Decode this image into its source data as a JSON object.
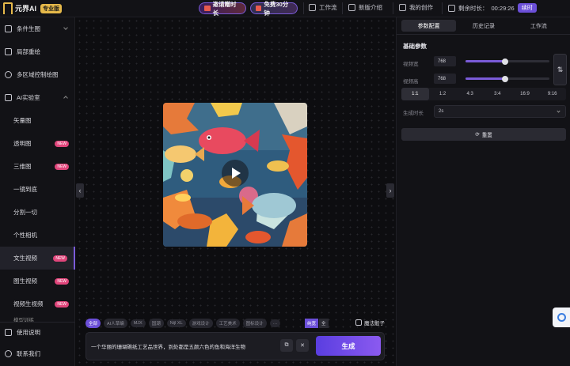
{
  "app": {
    "logo_text": "元界AI",
    "edition_badge": "专业版",
    "promo_invite": "邀请赠时长",
    "promo_free": "免费30分钟"
  },
  "topnav": {
    "workflow": "工作流",
    "new_intro": "新版介绍",
    "my_creations": "我的创作",
    "remaining_label": "剩余时长：",
    "remaining_time": "00:29:26",
    "renew_label": "续时"
  },
  "sidebar": {
    "items": [
      {
        "label": "条件生图",
        "icon": "grid-icon"
      },
      {
        "label": "局部重绘",
        "icon": "layers-icon"
      },
      {
        "label": "多区域控制绘图",
        "icon": "target-icon"
      },
      {
        "label": "AI实验室",
        "icon": "flask-icon"
      }
    ],
    "sub_items": [
      {
        "label": "矢量图",
        "new": false
      },
      {
        "label": "透明图",
        "new": true
      },
      {
        "label": "三维图",
        "new": true
      },
      {
        "label": "一镜到底",
        "new": false
      },
      {
        "label": "分割一切",
        "new": false
      },
      {
        "label": "个性相机",
        "new": false
      },
      {
        "label": "文生视频",
        "new": true
      },
      {
        "label": "图生视频",
        "new": true
      },
      {
        "label": "视频生视频",
        "new": true
      },
      {
        "label": "模型训练",
        "new": false
      }
    ],
    "new_badge": "NEW",
    "bottom": [
      {
        "label": "使用说明",
        "icon": "book-icon"
      },
      {
        "label": "联系我们",
        "icon": "chat-icon"
      }
    ]
  },
  "canvas": {
    "prev_arrow": "‹",
    "next_arrow": "›"
  },
  "prompt": {
    "tags": [
      "全部",
      "AI人草编",
      "MJX",
      "国潮",
      "Nijl XL",
      "游戏设计",
      "工艺美术",
      "图标设计",
      "…"
    ],
    "mode_toggle": [
      "纯宽",
      "全"
    ],
    "magic_label": "魔法骰子",
    "value": "一个华丽的珊瑚礁纸工艺品世界，到处都是五颜六色的鱼和海洋生物",
    "copy_icon": "⧉",
    "clear_icon": "✕",
    "generate_label": "生成"
  },
  "right_panel": {
    "tabs": [
      "参数配置",
      "历史记录",
      "工作流"
    ],
    "section_title": "基础参数",
    "width_label": "视频宽",
    "width_value": "768",
    "width_fraction": 0.47,
    "height_label": "视频高",
    "height_value": "768",
    "height_fraction": 0.47,
    "swap_icon": "⇅",
    "ratios": [
      "1:1",
      "1:2",
      "4:3",
      "3:4",
      "16:9",
      "9:16"
    ],
    "duration_label": "生成时长",
    "duration_value": "2s",
    "reset_label": "重置",
    "reset_icon": "⟳"
  },
  "colors": {
    "accent": "#7a5bd8",
    "generate_start": "#5a3ee0",
    "generate_end": "#8b5af0",
    "new_badge": "#e0457b",
    "brand_gold": "#e6b94a"
  }
}
